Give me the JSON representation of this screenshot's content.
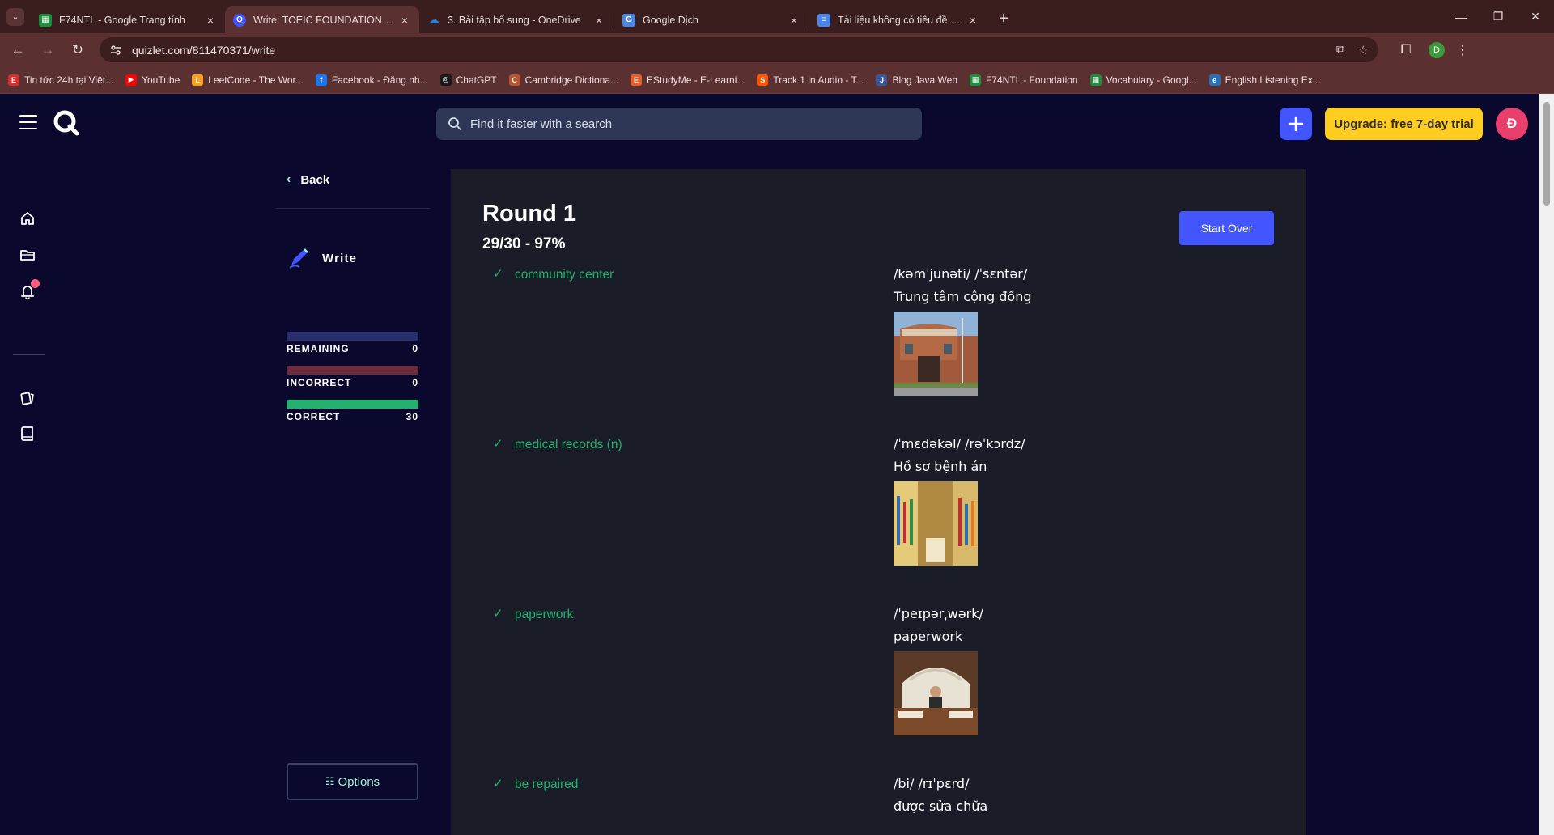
{
  "browser": {
    "tabs": [
      {
        "label": "F74NTL - Google Trang tính",
        "icon": "sheets-icon",
        "color": "#1e8e3e"
      },
      {
        "label": "Write: TOEIC FOUNDATION - LESSON",
        "icon": "quizlet-icon",
        "color": "#4255ff"
      },
      {
        "label": "3. Bài tập bổ sung - OneDrive",
        "icon": "onedrive-icon",
        "color": "#2a7fd4"
      },
      {
        "label": "Google Dịch",
        "icon": "translate-icon",
        "color": "#4a86e8"
      },
      {
        "label": "Tài liệu không có tiêu đề - Google",
        "icon": "docs-icon",
        "color": "#4a86e8"
      }
    ],
    "url": "quizlet.com/811470371/write",
    "profile_initial": "D",
    "bookmarks": [
      {
        "label": "Tin tức 24h tại Việt...",
        "color": "#d32f2f",
        "glyph": "E"
      },
      {
        "label": "YouTube",
        "color": "#ff0000",
        "glyph": "▶"
      },
      {
        "label": "LeetCode - The Wor...",
        "color": "#f89f1b",
        "glyph": "L"
      },
      {
        "label": "Facebook - Đăng nh...",
        "color": "#1877f2",
        "glyph": "f"
      },
      {
        "label": "ChatGPT",
        "color": "#1a1a1a",
        "glyph": "◎"
      },
      {
        "label": "Cambridge Dictiona...",
        "color": "#b5542d",
        "glyph": "C"
      },
      {
        "label": "EStudyMe - E-Learni...",
        "color": "#e85d2a",
        "glyph": "E"
      },
      {
        "label": "Track 1 in Audio - T...",
        "color": "#ff5500",
        "glyph": "S"
      },
      {
        "label": "Blog Java Web",
        "color": "#3b5998",
        "glyph": "J"
      },
      {
        "label": "F74NTL - Foundation",
        "color": "#1e8e3e",
        "glyph": "▦"
      },
      {
        "label": "Vocabulary - Googl...",
        "color": "#1e8e3e",
        "glyph": "▦"
      },
      {
        "label": "English Listening Ex...",
        "color": "#2a6fb0",
        "glyph": "e"
      }
    ]
  },
  "header": {
    "search_placeholder": "Find it faster with a search",
    "upgrade_label": "Upgrade: free 7-day trial",
    "avatar_initial": "Đ"
  },
  "side": {
    "back_label": "Back",
    "mode_label": "Write",
    "stats": [
      {
        "label": "REMAINING",
        "value": "0",
        "color": "#282e6e"
      },
      {
        "label": "INCORRECT",
        "value": "0",
        "color": "#6b2c3c"
      },
      {
        "label": "CORRECT",
        "value": "30",
        "color": "#23b26d"
      }
    ],
    "options_label": "Options"
  },
  "main": {
    "round_title": "Round 1",
    "round_score": "29/30 - 97%",
    "start_over_label": "Start Over",
    "terms": [
      {
        "term": "community center",
        "phonetic": "/kəmˈjunəti/ /ˈsɛntər/",
        "definition": "Trung tâm cộng đồng",
        "image": "community-center-photo"
      },
      {
        "term": "medical records (n)",
        "phonetic": "/ˈmɛdəkəl/ /rəˈkɔrdz/",
        "definition": "Hồ sơ bệnh án",
        "image": "medical-records-photo"
      },
      {
        "term": "paperwork",
        "phonetic": "/ˈpeɪpərˌwərk/",
        "definition": "paperwork",
        "image": "paperwork-photo"
      },
      {
        "term": "be repaired",
        "phonetic": "/bi/ /rɪˈpɛrd/",
        "definition": "được sửa chữa",
        "image": ""
      }
    ]
  }
}
